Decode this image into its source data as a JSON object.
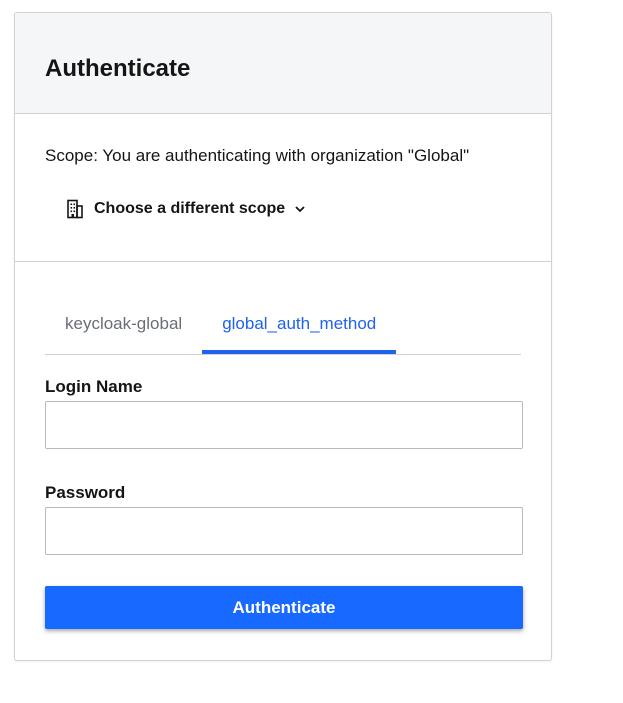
{
  "header": {
    "title": "Authenticate"
  },
  "scope": {
    "description": "Scope: You are authenticating with organization \"Global\"",
    "change_label": "Choose a different scope"
  },
  "tabs": [
    {
      "label": "keycloak-global",
      "active": false
    },
    {
      "label": "global_auth_method",
      "active": true
    }
  ],
  "form": {
    "login_label": "Login Name",
    "login_value": "",
    "password_label": "Password",
    "password_value": "",
    "submit_label": "Authenticate"
  },
  "colors": {
    "accent": "#1f62f0",
    "button": "#1769ff",
    "header_bg": "#f5f6f7"
  }
}
